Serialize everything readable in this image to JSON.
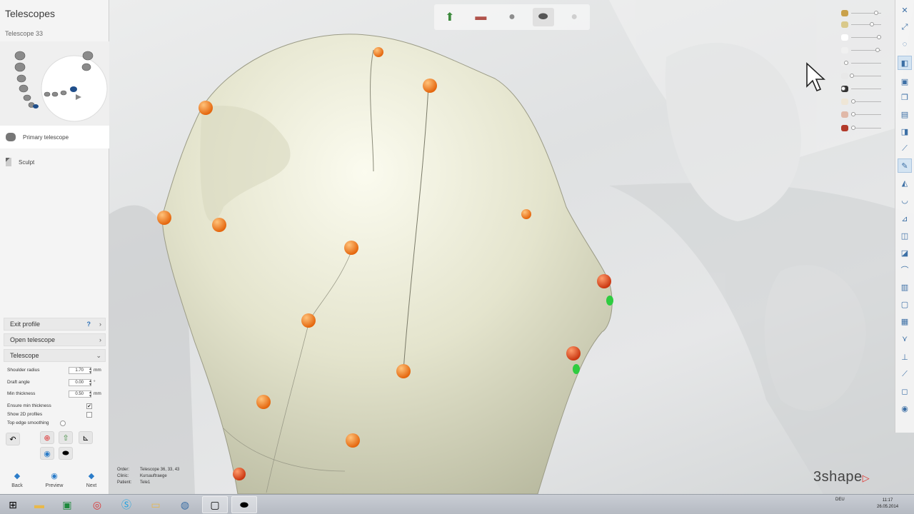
{
  "panel": {
    "title": "Telescopes",
    "subtitle": "Telescope 33",
    "steps": [
      {
        "label": "Primary telescope",
        "active": true
      },
      {
        "label": "Sculpt",
        "active": false
      }
    ],
    "sections": {
      "exit_profile": "Exit profile",
      "open_telescope": "Open telescope",
      "telescope": "Telescope"
    },
    "params": {
      "shoulder_radius": {
        "label": "Shoulder radius",
        "value": "1.70",
        "unit": "mm"
      },
      "draft_angle": {
        "label": "Draft angle",
        "value": "0.00",
        "unit": "°"
      },
      "min_thickness": {
        "label": "Min thickness",
        "value": "0.50",
        "unit": "mm"
      }
    },
    "checks": {
      "ensure_min_thickness": {
        "label": "Ensure min thickness",
        "checked": true,
        "mark": "✔"
      },
      "show_2d_profiles": {
        "label": "Show 2D profiles",
        "checked": false,
        "mark": ""
      },
      "top_edge_smoothing": {
        "label": "Top edge smoothing",
        "checked": false
      }
    },
    "nav": {
      "back": "Back",
      "preview": "Preview",
      "next": "Next"
    }
  },
  "order_info": {
    "order_key": "Order:",
    "order_val": "Telescope 36, 33, 43",
    "clinic_key": "Clinic:",
    "clinic_val": "Kursauftraege",
    "patient_key": "Patient:",
    "patient_val": "Tele1"
  },
  "brand": {
    "logo": "3shape",
    "accent": "#e0312b"
  },
  "colors": {
    "control_point": "#f07a16",
    "control_point_red": "#e04a1a",
    "green_point": "#2ecc40",
    "telescope_surface": "#e6e6d0"
  },
  "taskbar": {
    "time": "11:17",
    "date": "26.05.2014",
    "lang": "DEU"
  },
  "top_tools": [
    "insertion-direction",
    "model-view",
    "telescope-view",
    "crown-view",
    "transparency-view"
  ],
  "right_tools": [
    "close-icon",
    "fullscreen-icon",
    "settings-icon",
    "view-icon",
    "cube-icon",
    "copy-icon",
    "layers-icon",
    "move-icon",
    "sculpt-icon",
    "measure-icon",
    "palette-icon"
  ]
}
